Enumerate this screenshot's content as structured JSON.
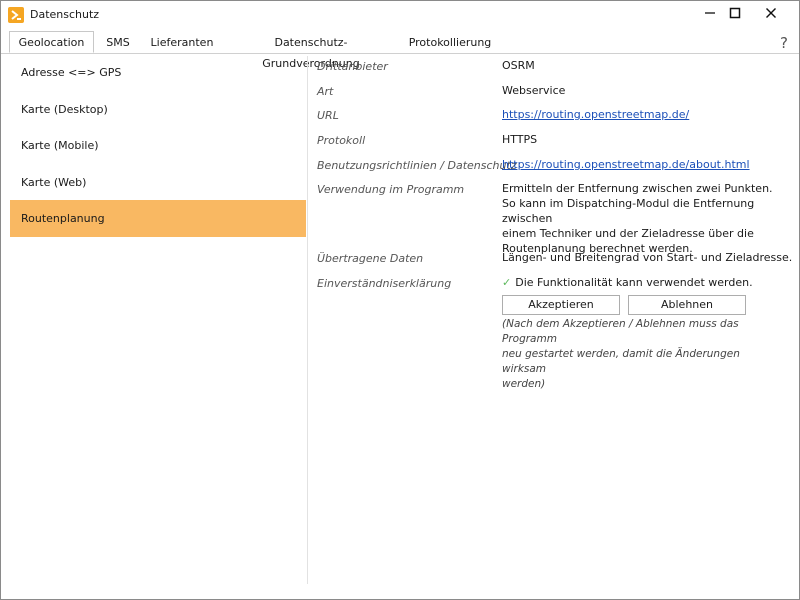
{
  "window": {
    "title": "Datenschutz"
  },
  "icons": {
    "app": "arrow-right-icon",
    "minimize": "minimize-icon",
    "maximize": "maximize-icon",
    "close": "close-icon",
    "help": "question-icon",
    "check": "checkmark-icon"
  },
  "help": {
    "label": "?"
  },
  "tabs": [
    {
      "label": "Geolocation",
      "active": true
    },
    {
      "label": "SMS"
    },
    {
      "label": "Lieferanten"
    },
    {
      "label": "Datenschutz-Grundverordnung"
    },
    {
      "label": "Protokollierung"
    }
  ],
  "sidebar": {
    "items": [
      {
        "label": "Adresse <=> GPS"
      },
      {
        "label": "Karte (Desktop)"
      },
      {
        "label": "Karte (Mobile)"
      },
      {
        "label": "Karte (Web)"
      },
      {
        "label": "Routenplanung",
        "selected": true
      }
    ]
  },
  "details": {
    "drittanbieter": {
      "label": "Drittanbieter",
      "value": "OSRM"
    },
    "art": {
      "label": "Art",
      "value": "Webservice"
    },
    "url": {
      "label": "URL",
      "value": "https://routing.openstreetmap.de/"
    },
    "protokoll": {
      "label": "Protokoll",
      "value": "HTTPS"
    },
    "richtlinien": {
      "label": "Benutzungsrichtlinien / Datenschutz",
      "value": "https://routing.openstreetmap.de/about.html"
    },
    "verwendung": {
      "label": "Verwendung im Programm",
      "lines": [
        "Ermitteln der Entfernung zwischen zwei Punkten.",
        "So kann im Dispatching-Modul die Entfernung zwischen",
        "einem Techniker und der Zieladresse über die",
        "Routenplanung berechnet werden."
      ]
    },
    "daten": {
      "label": "Übertragene Daten",
      "value": "Längen- und Breitengrad von Start- und Zieladresse."
    },
    "einverstaendnis": {
      "label": "Einverständniserklärung",
      "check": "✓",
      "value": "Die Funktionalität kann verwendet werden."
    }
  },
  "buttons": {
    "accept": "Akzeptieren",
    "decline": "Ablehnen"
  },
  "note": {
    "lines": [
      "(Nach dem Akzeptieren / Ablehnen muss das Programm",
      "neu gestartet werden, damit die Änderungen wirksam",
      "werden)"
    ]
  },
  "colors": {
    "selected_bg": "#f9b862",
    "link": "#1b4fb8",
    "app_icon": "#f5a623",
    "check": "#5cb85c"
  }
}
